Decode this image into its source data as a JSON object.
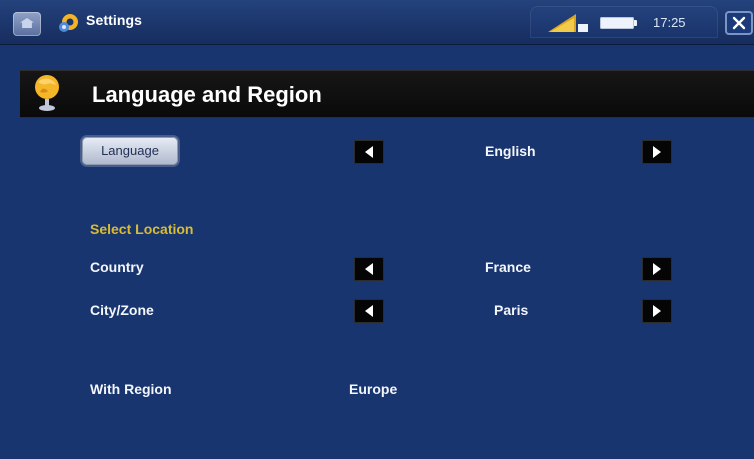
{
  "topbar": {
    "title": "Settings",
    "time": "17:25",
    "icons": {
      "home": "home-icon",
      "settings": "settings-icon",
      "signal": "signal-icon",
      "battery": "battery-icon",
      "close": "close-icon"
    }
  },
  "section": {
    "title": "Language and Region",
    "icon": "globe-icon"
  },
  "language": {
    "button_label": "Language",
    "value": "English"
  },
  "location": {
    "heading": "Select Location",
    "country_label": "Country",
    "country_value": "France",
    "city_label": "City/Zone",
    "city_value": "Paris",
    "region_label": "With Region",
    "region_value": "Europe"
  },
  "colors": {
    "background": "#19356f",
    "header_bar": "#0b0b0b",
    "accent_label": "#d7bc35"
  }
}
